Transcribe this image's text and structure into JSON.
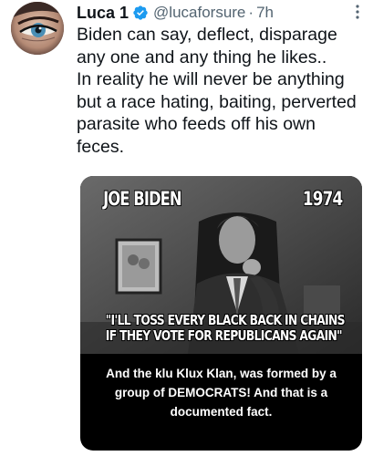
{
  "tweet": {
    "display_name": "Luca 1",
    "handle": "@lucaforsure",
    "separator": "·",
    "time": "7h",
    "text": "Biden can say, deflect, disparage any one and any thing he likes..\nIn reality he will never be anything but a race hating, baiting, perverted parasite who feeds off his own feces.",
    "icons": {
      "avatar": "avatar",
      "verified": "verified-badge-icon",
      "more": "more-options-icon"
    },
    "colors": {
      "verified": "#1d9bf0",
      "secondary_text": "#536471",
      "primary_text": "#0f1419"
    }
  },
  "media": {
    "name_label": "JOE BIDEN",
    "year_label": "1974",
    "quote_line_1": "\"I'LL TOSS EVERY BLACK BACK IN CHAINS",
    "quote_line_2": "IF THEY VOTE FOR REPUBLICANS AGAIN\"",
    "caption": "And the klu Klux Klan, was formed by a group of DEMOCRATS! And that is a documented fact."
  }
}
